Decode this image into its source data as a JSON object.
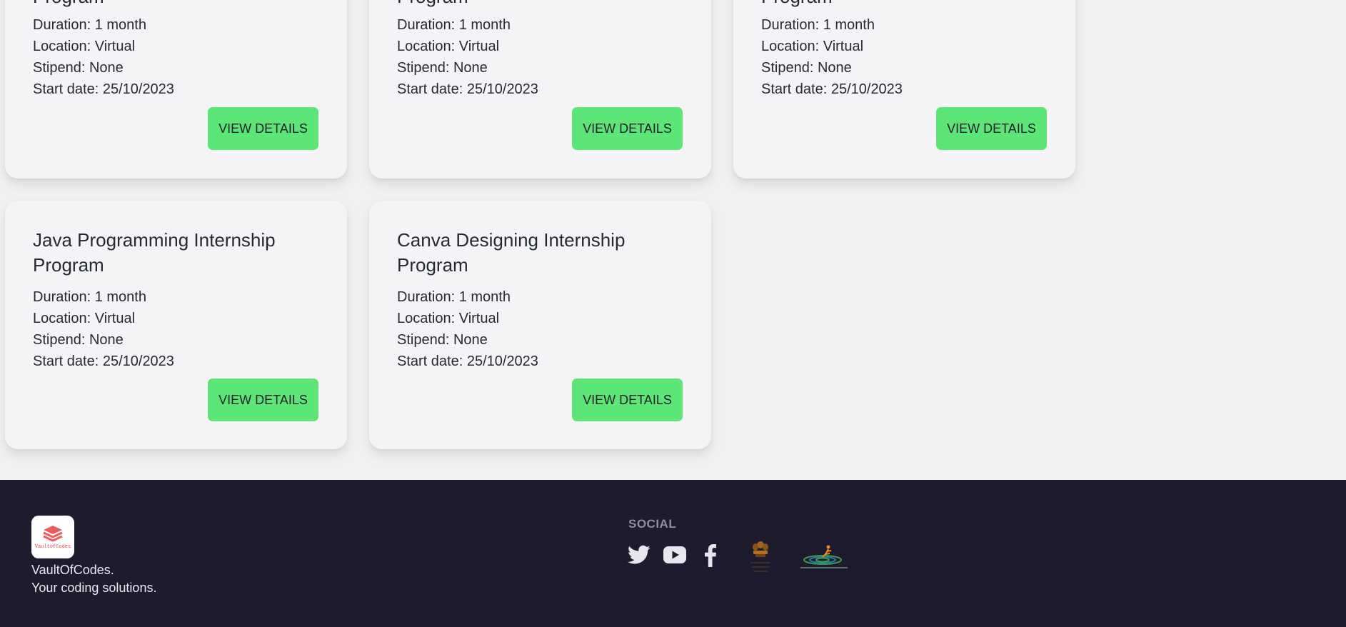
{
  "cards_top": [
    {
      "title_tail": "Program",
      "duration": "Duration: 1 month",
      "location": "Location: Virtual",
      "stipend": "Stipend: None",
      "start": "Start date: 25/10/2023",
      "button": "VIEW DETAILS"
    },
    {
      "title_tail": "Program",
      "duration": "Duration: 1 month",
      "location": "Location: Virtual",
      "stipend": "Stipend: None",
      "start": "Start date: 25/10/2023",
      "button": "VIEW DETAILS"
    },
    {
      "title_tail": "Program",
      "duration": "Duration: 1 month",
      "location": "Location: Virtual",
      "stipend": "Stipend: None",
      "start": "Start date: 25/10/2023",
      "button": "VIEW DETAILS"
    }
  ],
  "cards_bottom": [
    {
      "title": "Java Programming Internship Program",
      "duration": "Duration: 1 month",
      "location": "Location: Virtual",
      "stipend": "Stipend: None",
      "start": "Start date: 25/10/2023",
      "button": "VIEW DETAILS"
    },
    {
      "title": "Canva Designing Internship Program",
      "duration": "Duration: 1 month",
      "location": "Location: Virtual",
      "stipend": "Stipend: None",
      "start": "Start date: 25/10/2023",
      "button": "VIEW DETAILS"
    }
  ],
  "footer": {
    "logo_text": "VaultofCodes",
    "brand_name": "VaultOfCodes.",
    "tagline": "Your coding solutions.",
    "social_heading": "SOCIAL",
    "icons": [
      "twitter-icon",
      "youtube-icon",
      "facebook-icon",
      "india-emblem-logo",
      "national-career-service-logo"
    ]
  },
  "colors": {
    "button_green": "#5de678",
    "footer_bg": "#1e1b2e",
    "card_bg": "#f4f4f7"
  }
}
